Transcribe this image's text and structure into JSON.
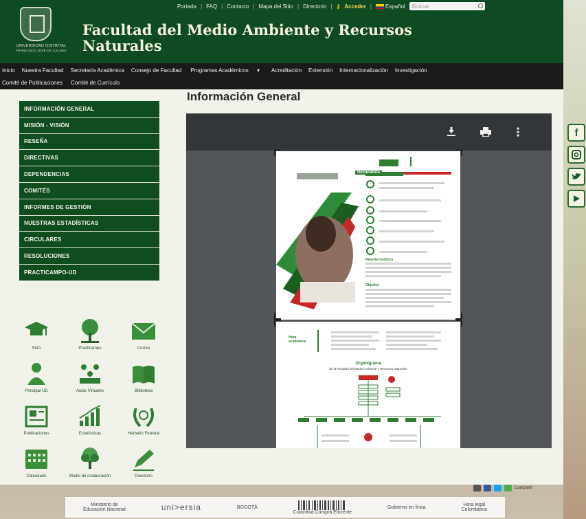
{
  "header": {
    "title_line1": "Facultad del Medio Ambiente y Recursos",
    "title_line2": "Naturales",
    "university_line1": "UNIVERSIDAD DISTRITAL",
    "university_line2": "FRANCISCO JOSÉ DE CALDAS",
    "top_links": [
      "Portada",
      "FAQ",
      "Contacto",
      "Mapa del Sitio",
      "Directorio"
    ],
    "login_label": "Acceder",
    "language_label": "Español",
    "search_placeholder": "Buscar"
  },
  "main_nav": {
    "row1": [
      "Inicio",
      "Nuestra Facultad",
      "Secretaría Académica",
      "Consejo de Facultad",
      "Programas Académicos",
      "Acreditación",
      "Extensión",
      "Internacionalización",
      "Investigación"
    ],
    "row2": [
      "Comité de Publicaciones",
      "Comité de Currículo"
    ],
    "dropdown_glyph": "▾"
  },
  "sidebar": {
    "items": [
      {
        "label": "INFORMACIÓN GENERAL"
      },
      {
        "label": "MISIÓN - VISIÓN"
      },
      {
        "label": "RESEÑA"
      },
      {
        "label": "DIRECTIVAS"
      },
      {
        "label": "DEPENDENCIAS"
      },
      {
        "label": "COMITÉS"
      },
      {
        "label": "INFORMES DE GESTIÓN"
      },
      {
        "label": "NUESTRAS ESTADÍSTICAS"
      },
      {
        "label": "CIRCULARES"
      },
      {
        "label": "RESOLUCIONES"
      },
      {
        "label": "PRACTICAMPO-UD"
      }
    ]
  },
  "quick_links": [
    {
      "label": "SGA",
      "icon": "graduation-cap-icon"
    },
    {
      "label": "Practicampo",
      "icon": "tree-icon"
    },
    {
      "label": "Correo",
      "icon": "envelope-icon"
    },
    {
      "label": "Principal UD",
      "icon": "person-icon"
    },
    {
      "label": "Aulas Virtuales",
      "icon": "classroom-icon"
    },
    {
      "label": "Biblioteca",
      "icon": "book-icon"
    },
    {
      "label": "Publicaciones",
      "icon": "newspaper-icon"
    },
    {
      "label": "Estadísticas",
      "icon": "chart-icon"
    },
    {
      "label": "Herbario Forestal",
      "icon": "laurel-icon"
    },
    {
      "label": "Calendario",
      "icon": "calendar-icon"
    },
    {
      "label": "Medio de colaboración",
      "icon": "tree-icon"
    },
    {
      "label": "Directorio",
      "icon": "pen-icon"
    }
  ],
  "main": {
    "heading": "Información General"
  },
  "viewer": {
    "page1_heading": "Decanatura",
    "page1_section": "Reseña histórica",
    "page1_section2": "Objetivo",
    "page2_side_label": "Hora\nacadémica",
    "page2_heading_line1": "Organigrama",
    "page2_heading_line2": "de la Facultad del Medio Ambiente y Recursos Naturales"
  },
  "share": {
    "label": "Compartir"
  },
  "footer": {
    "logos": [
      {
        "line1": "Ministerio de",
        "line2": "Educación Nacional"
      },
      {
        "big": "uni>ersia"
      },
      {
        "big": "BOGOTÁ"
      },
      {
        "line1": "Colombia Compra Eficiente"
      },
      {
        "line1": "Gobierno en línea"
      },
      {
        "line1": "Hora legal",
        "line2": "Colombiana"
      }
    ]
  },
  "colors": {
    "header_green": "#0f4b22",
    "sidebar_green": "#0d4d1f",
    "nav_black": "#1a1a1a",
    "viewer_bg": "#525659",
    "toolbar": "#323639"
  }
}
